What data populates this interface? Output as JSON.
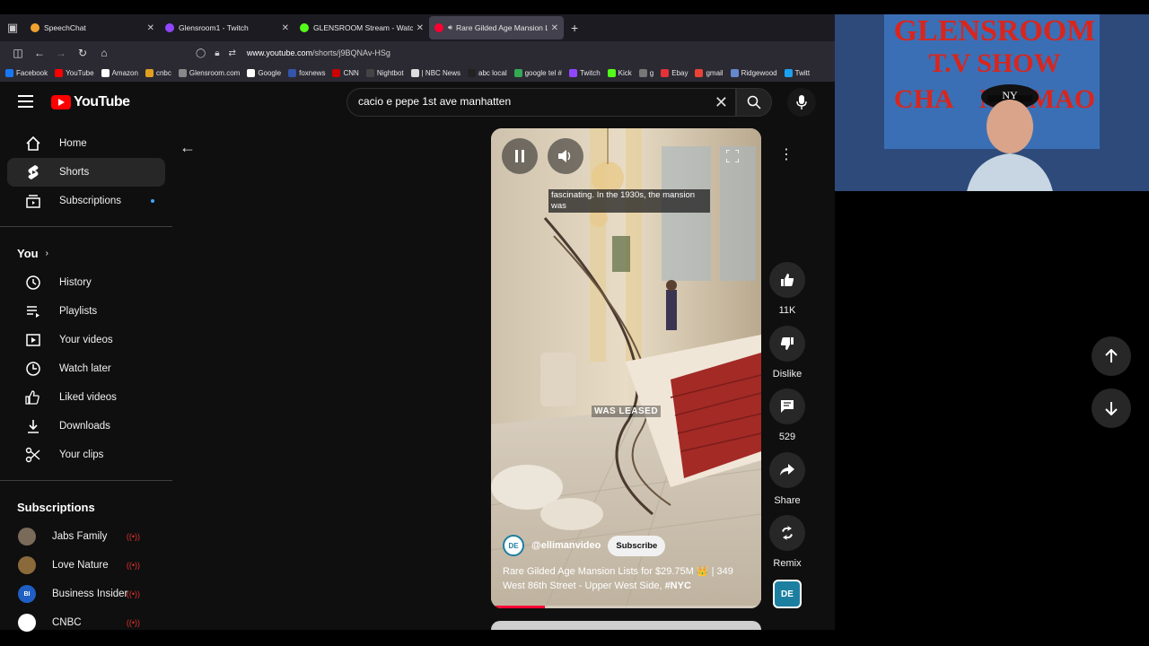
{
  "browser": {
    "tabs": [
      {
        "title": "SpeechChat",
        "color": "#f0a030",
        "active": false
      },
      {
        "title": "Glensroom1 - Twitch",
        "color": "#9146ff",
        "active": false
      },
      {
        "title": "GLENSROOM Stream - Watch L",
        "color": "#53fc18",
        "active": false
      },
      {
        "title": "Rare Gilded Age Mansion Li",
        "color": "#ff0033",
        "active": true
      }
    ],
    "new_tab": "+",
    "url_host": "www.youtube.com",
    "url_path": "/shorts/j9BQNAv-HSg",
    "bookmarks": [
      {
        "label": "Facebook",
        "color": "#1877f2"
      },
      {
        "label": "YouTube",
        "color": "#ff0000"
      },
      {
        "label": "Amazon",
        "color": "#ffffff"
      },
      {
        "label": "cnbc",
        "color": "#e0a020"
      },
      {
        "label": "Glensroom.com",
        "color": "#888888"
      },
      {
        "label": "Google",
        "color": "#ffffff"
      },
      {
        "label": "foxnews",
        "color": "#3355aa"
      },
      {
        "label": "CNN",
        "color": "#cc0000"
      },
      {
        "label": "Nightbot",
        "color": "#444444"
      },
      {
        "label": "| NBC News",
        "color": "#dddddd"
      },
      {
        "label": "abc local",
        "color": "#222222"
      },
      {
        "label": "google tel #",
        "color": "#34a853"
      },
      {
        "label": "Twitch",
        "color": "#9146ff"
      },
      {
        "label": "Kick",
        "color": "#53fc18"
      },
      {
        "label": "g",
        "color": "#777777"
      },
      {
        "label": "Ebay",
        "color": "#e53238"
      },
      {
        "label": "gmail",
        "color": "#ea4335"
      },
      {
        "label": "Ridgewood",
        "color": "#6688cc"
      },
      {
        "label": "Twitt",
        "color": "#1da1f2"
      }
    ]
  },
  "youtube": {
    "logo_text": "YouTube",
    "search": {
      "value": "cacio e pepe 1st ave manhatten"
    },
    "sidebar": {
      "main": [
        {
          "label": "Home",
          "icon": "home-icon",
          "active": false
        },
        {
          "label": "Shorts",
          "icon": "shorts-icon",
          "active": true
        },
        {
          "label": "Subscriptions",
          "icon": "subscriptions-icon",
          "active": false,
          "dot": true
        }
      ],
      "you_header": "You",
      "you": [
        {
          "label": "History",
          "icon": "history-icon"
        },
        {
          "label": "Playlists",
          "icon": "playlists-icon"
        },
        {
          "label": "Your videos",
          "icon": "your-videos-icon"
        },
        {
          "label": "Watch later",
          "icon": "watch-later-icon"
        },
        {
          "label": "Liked videos",
          "icon": "liked-videos-icon"
        },
        {
          "label": "Downloads",
          "icon": "downloads-icon"
        },
        {
          "label": "Your clips",
          "icon": "clips-icon"
        }
      ],
      "subscriptions_header": "Subscriptions",
      "subscriptions": [
        {
          "label": "Jabs Family",
          "avatar_color": "#7a6a5a",
          "avatar_text": ""
        },
        {
          "label": "Love Nature",
          "avatar_color": "#8a6a3a",
          "avatar_text": ""
        },
        {
          "label": "Business Insider",
          "avatar_color": "#1f5fc4",
          "avatar_text": "BI"
        },
        {
          "label": "CNBC",
          "avatar_color": "#ffffff",
          "avatar_text": ""
        }
      ]
    },
    "short": {
      "caption": "fascinating. In the 1930s, the mansion was",
      "overlay": "WAS LEASED",
      "channel": "@ellimanvideo",
      "subscribe": "Subscribe",
      "title_main": "Rare Gilded Age Mansion Lists for $29.75M 👑 | 349 West 86th Street - Upper West Side, ",
      "title_tag": "#NYC",
      "progress": 0.2
    },
    "actions": {
      "likes": "11K",
      "dislike": "Dislike",
      "comments": "529",
      "share": "Share",
      "remix": "Remix"
    }
  },
  "webcam": {
    "line1": "GLENSROOM",
    "line2": "T.V SHOW",
    "line3": "CHA    M LMAO"
  }
}
